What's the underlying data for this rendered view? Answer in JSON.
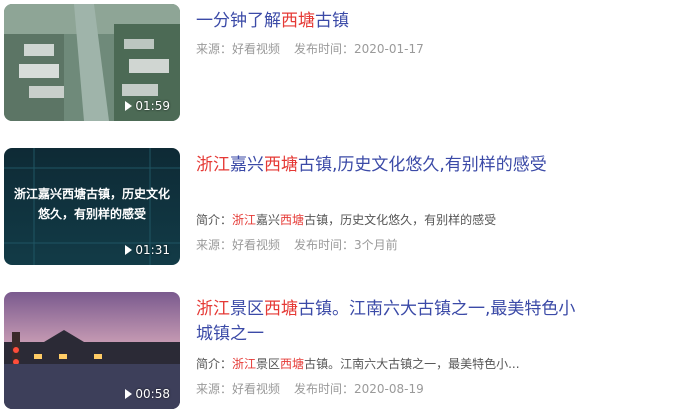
{
  "items": [
    {
      "title_parts": [
        "一分钟了解",
        "西塘",
        "古镇"
      ],
      "duration": "01:59",
      "source_label": "来源：好看视频",
      "publish_label": "发布时间：2020-01-17"
    },
    {
      "title_parts": [
        "浙江",
        "嘉兴",
        "西塘",
        "古镇,历史文化悠久,有别样的感受"
      ],
      "duration": "01:31",
      "thumb_text": "浙江嘉兴西塘古镇，历史文化悠久，有别样的感受",
      "desc_prefix": "简介：",
      "desc_parts": [
        "浙江",
        "嘉兴",
        "西塘",
        "古镇，历史文化悠久，有别样的感受"
      ],
      "source_label": "来源：好看视频",
      "publish_label": "发布时间：3个月前"
    },
    {
      "title_parts": [
        "浙江",
        "景区",
        "西塘",
        "古镇。江南六大古镇之一,最美特色小城镇之一"
      ],
      "duration": "00:58",
      "desc_prefix": "简介：",
      "desc_parts": [
        "浙江",
        "景区",
        "西塘",
        "古镇。江南六大古镇之一，最美特色小..."
      ],
      "source_label": "来源：好看视频",
      "publish_label": "发布时间：2020-08-19"
    }
  ],
  "colors": {
    "link": "#3b4aa7",
    "highlight": "#e53935",
    "meta": "#9a9a9a"
  }
}
